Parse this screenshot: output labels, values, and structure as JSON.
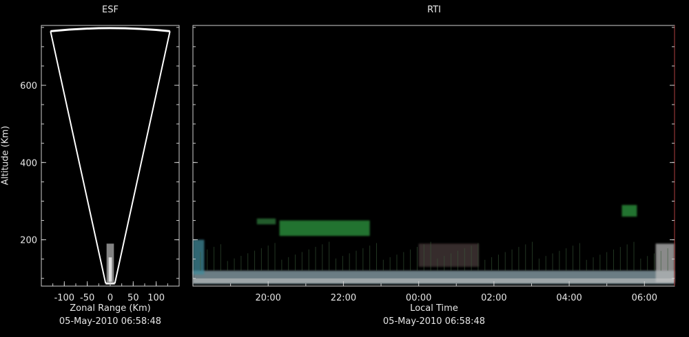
{
  "chart_data": [
    {
      "type": "scatter",
      "title": "ESF",
      "xlabel": "Zonal Range (Km)",
      "ylabel": "Altitude (Km)",
      "xlim": [
        -150,
        150
      ],
      "ylim": [
        80,
        755
      ],
      "xticks": [
        -100,
        -50,
        0,
        50,
        100
      ],
      "xtick_labels": [
        "-100",
        "-50",
        "0",
        "50",
        "100"
      ],
      "yticks": [
        200,
        400,
        600
      ],
      "ytick_labels": [
        "200",
        "400",
        "600"
      ],
      "timestamp": "05-May-2010 06:58:48",
      "beam_cone": {
        "apex_altitude": 87,
        "top_altitude": 740,
        "half_width_at_top": 130
      },
      "echo_band": {
        "x_range": [
          -8,
          8
        ],
        "altitude_range": [
          88,
          190
        ]
      },
      "grid": false
    },
    {
      "type": "heatmap",
      "title": "RTI",
      "xlabel": "Local Time",
      "xlim_hours": [
        18.0,
        30.8
      ],
      "ylim": [
        80,
        755
      ],
      "xticks_hours": [
        20,
        22,
        24,
        26,
        28,
        30
      ],
      "xtick_labels": [
        "20:00",
        "22:00",
        "00:00",
        "02:00",
        "04:00",
        "06:00"
      ],
      "yticks": [
        200,
        400,
        600
      ],
      "timestamp": "05-May-2010 06:58:48",
      "grid": false,
      "echo_regions": [
        {
          "time_start": 18.0,
          "time_end": 30.8,
          "alt_low": 85,
          "alt_high": 120,
          "color": "#8fa7b0"
        },
        {
          "time_start": 20.3,
          "time_end": 22.7,
          "alt_low": 210,
          "alt_high": 250,
          "color": "#2f9a3f"
        },
        {
          "time_start": 19.7,
          "time_end": 20.2,
          "alt_low": 240,
          "alt_high": 255,
          "color": "#2f7a3a"
        },
        {
          "time_start": 29.4,
          "time_end": 29.8,
          "alt_low": 260,
          "alt_high": 290,
          "color": "#2f9a3f"
        },
        {
          "time_start": 18.0,
          "time_end": 18.3,
          "alt_low": 110,
          "alt_high": 200,
          "color": "#3f8a9a"
        },
        {
          "time_start": 30.3,
          "time_end": 30.8,
          "alt_low": 90,
          "alt_high": 190,
          "color": "#b8b8b8"
        },
        {
          "time_start": 24.0,
          "time_end": 25.6,
          "alt_low": 130,
          "alt_high": 190,
          "color": "#4a3a3a"
        }
      ]
    }
  ]
}
